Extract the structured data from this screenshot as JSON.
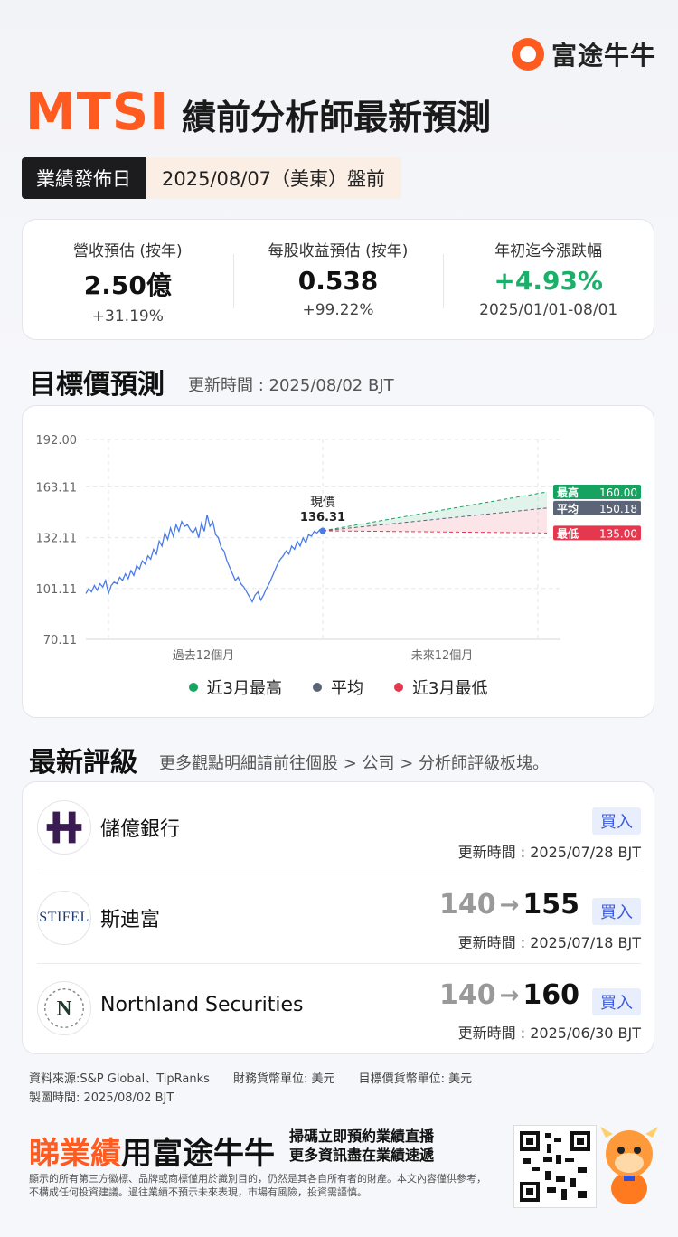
{
  "brand": {
    "name": "富途牛牛"
  },
  "header": {
    "ticker": "MTSI",
    "title": "績前分析師最新預測"
  },
  "earnings_date": {
    "label": "業績發佈日",
    "value": "2025/08/07（美東）盤前"
  },
  "stats": [
    {
      "label": "營收預估 (按年)",
      "value": "2.50億",
      "sub": "+31.19%"
    },
    {
      "label": "每股收益預估 (按年)",
      "value": "0.538",
      "sub": "+99.22%"
    },
    {
      "label": "年初迄今漲跌幅",
      "value": "+4.93%",
      "sub": "2025/01/01-08/01"
    }
  ],
  "target_section": {
    "title": "目標價預測",
    "updated": "更新時間 : 2025/08/02 BJT"
  },
  "chart_data": {
    "type": "line",
    "yticks": [
      "192.00",
      "163.11",
      "132.11",
      "101.11",
      "70.11"
    ],
    "ylim": [
      70.11,
      192.0
    ],
    "xlabels": [
      "過去12個月",
      "未來12個月"
    ],
    "current": {
      "label": "現價",
      "value": "136.31"
    },
    "targets": [
      {
        "name": "最高",
        "value": "160.00",
        "color": "#16a35f"
      },
      {
        "name": "平均",
        "value": "150.18",
        "color": "#5b6577"
      },
      {
        "name": "最低",
        "value": "135.00",
        "color": "#e5384e"
      }
    ],
    "legend": [
      {
        "label": "近3月最高",
        "color": "#16a35f"
      },
      {
        "label": "平均",
        "color": "#5b6577"
      },
      {
        "label": "近3月最低",
        "color": "#e5384e"
      }
    ],
    "history": [
      98,
      101,
      99,
      103,
      100,
      104,
      102,
      106,
      98,
      103,
      105,
      104,
      108,
      106,
      110,
      107,
      112,
      109,
      115,
      113,
      118,
      116,
      121,
      119,
      125,
      122,
      130,
      127,
      135,
      131,
      138,
      133,
      140,
      136,
      142,
      139,
      140,
      137,
      135,
      138,
      132,
      141,
      136,
      146,
      139,
      142,
      134,
      132,
      126,
      124,
      118,
      114,
      110,
      106,
      108,
      104,
      102,
      99,
      96,
      93,
      97,
      99,
      94,
      97,
      101,
      104,
      108,
      112,
      116,
      119,
      121,
      124,
      122,
      127,
      125,
      130,
      127,
      132,
      129,
      134,
      133,
      136,
      135,
      137,
      136
    ]
  },
  "ratings_section": {
    "title": "最新評級",
    "sub": "更多觀點明細請前往個股 > 公司 > 分析師評級板塊。"
  },
  "ratings": [
    {
      "broker": "儲億銀行",
      "from": "",
      "to": "",
      "rating": "買入",
      "updated": "更新時間 : 2025/07/28 BJT"
    },
    {
      "broker": "斯迪富",
      "from": "140",
      "to": "155",
      "rating": "買入",
      "updated": "更新時間 : 2025/07/18 BJT"
    },
    {
      "broker": "Northland Securities",
      "from": "140",
      "to": "160",
      "rating": "買入",
      "updated": "更新時間 : 2025/06/30 BJT"
    }
  ],
  "logos": {
    "stifel": "STIFEL",
    "northland": "N"
  },
  "footer": {
    "source": "資料來源:S&P Global、TipRanks",
    "finance_unit": "財務貨幣單位: 美元",
    "target_unit": "目標價貨幣單位: 美元",
    "made": "製圖時間: 2025/08/02 BJT",
    "slogan_a": "睇業績",
    "slogan_b": "用富途牛牛",
    "cta_1": "掃碼立即預約業績直播",
    "cta_2": "更多資訊盡在業績速遞",
    "disclaimer": "顯示的所有第三方徽標、品牌或商標僅用於識別目的，仍然是其各自所有者的財產。本文內容僅供參考，不構成任何投資建議。過往業績不預示未來表現，市場有風險，投資需謹慎。"
  }
}
